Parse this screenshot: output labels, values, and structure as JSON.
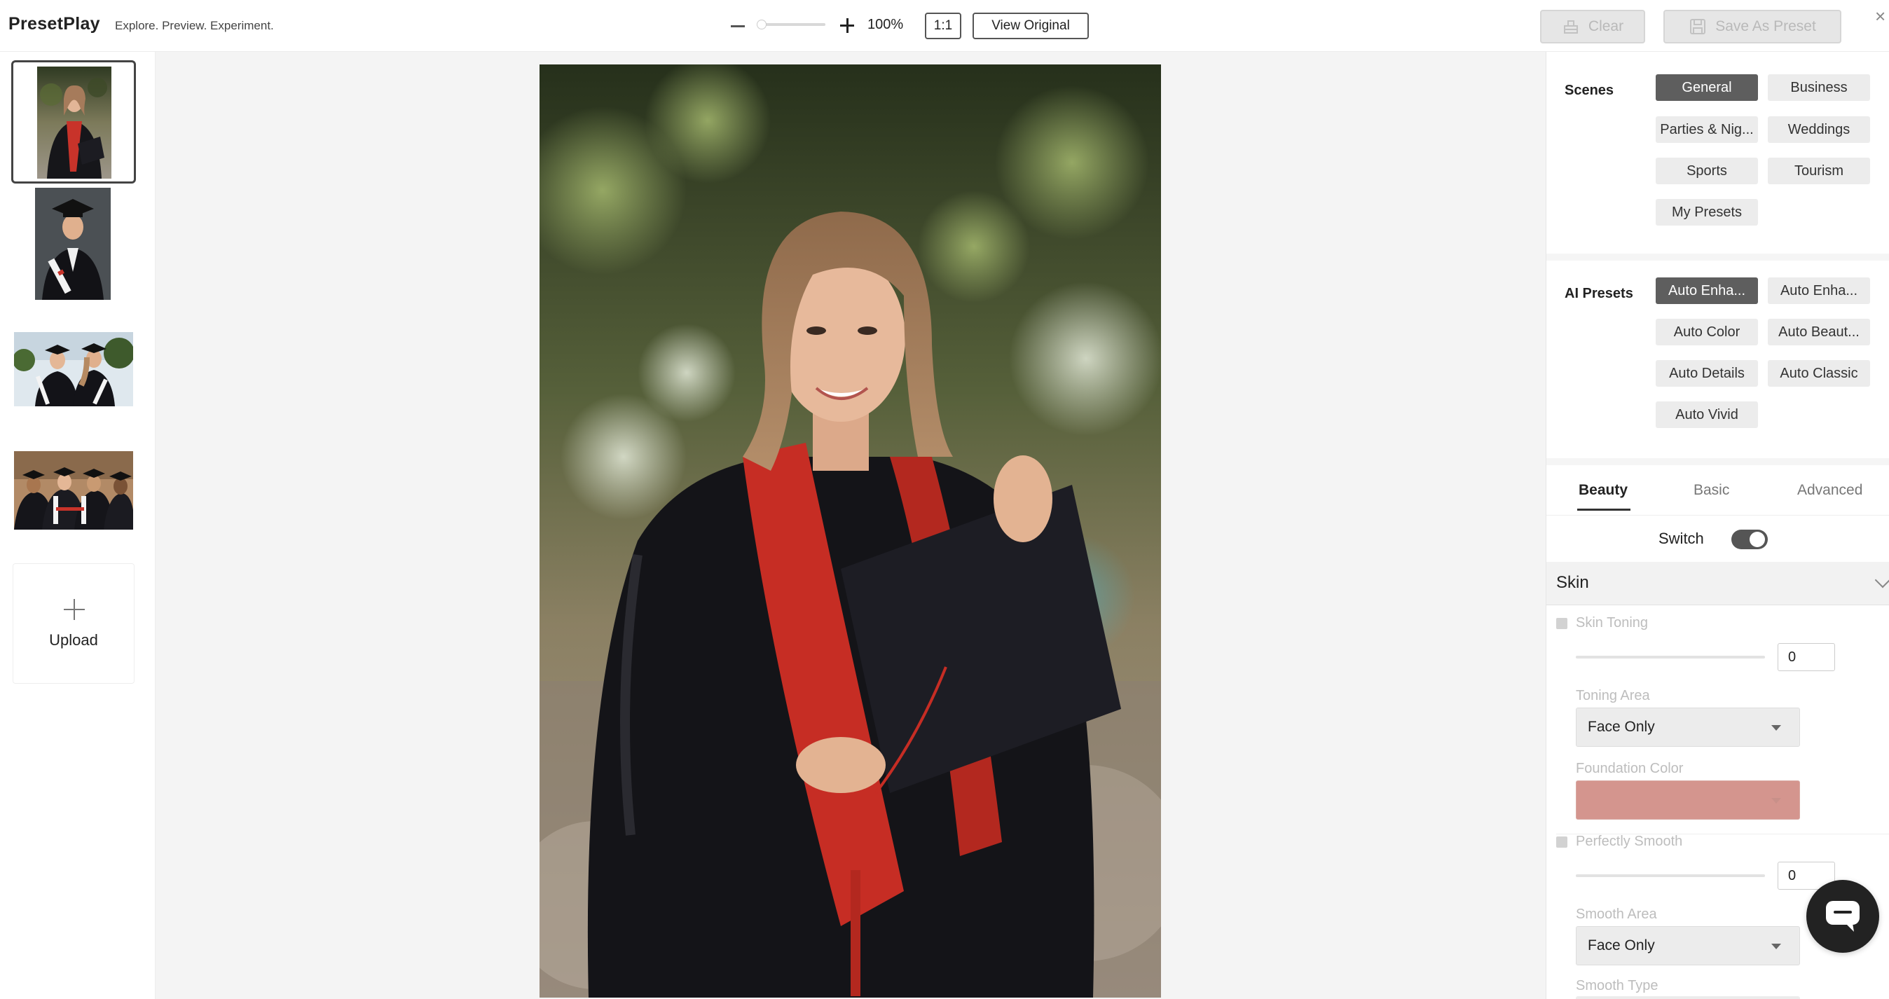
{
  "app": {
    "brand": "PresetPlay",
    "tagline": "Explore. Preview. Experiment."
  },
  "toolbar": {
    "zoom_level": "100%",
    "zoom_value": 100,
    "one_to_one_label": "1:1",
    "view_original_label": "View Original",
    "clear_label": "Clear",
    "save_preset_label": "Save As Preset"
  },
  "thumbnails": {
    "items": [
      {
        "subject": "graduate woman with red stole holding cap",
        "selected": true
      },
      {
        "subject": "graduate man with cap holding diploma",
        "selected": false
      },
      {
        "subject": "two graduates with diplomas outdoors",
        "selected": false
      },
      {
        "subject": "group of graduates holding diplomas",
        "selected": false
      }
    ],
    "upload_label": "Upload"
  },
  "scenes": {
    "label": "Scenes",
    "items": [
      "General",
      "Business",
      "Parties & Nig...",
      "Weddings",
      "Sports",
      "Tourism",
      "My Presets"
    ],
    "active": "General"
  },
  "ai_presets": {
    "label": "AI Presets",
    "items": [
      "Auto Enha...",
      "Auto Enha...",
      "Auto Color",
      "Auto Beaut...",
      "Auto Details",
      "Auto Classic",
      "Auto Vivid"
    ],
    "active_index": 0
  },
  "tabs": {
    "items": [
      "Beauty",
      "Basic",
      "Advanced"
    ],
    "active": "Beauty"
  },
  "switch": {
    "label": "Switch",
    "on": true
  },
  "skin": {
    "title": "Skin",
    "skin_toning": {
      "label": "Skin Toning",
      "value": "0"
    },
    "toning_area": {
      "label": "Toning Area",
      "value": "Face Only"
    },
    "foundation_color": {
      "label": "Foundation Color",
      "color": "#d4958e"
    },
    "perfectly_smooth": {
      "label": "Perfectly Smooth",
      "value": "0"
    },
    "smooth_area": {
      "label": "Smooth Area",
      "value": "Face Only"
    },
    "smooth_type": {
      "label": "Smooth Type"
    }
  },
  "icons": {
    "close": "close-icon",
    "clear": "eraser-icon",
    "save": "save-icon",
    "chat": "chat-icon"
  }
}
